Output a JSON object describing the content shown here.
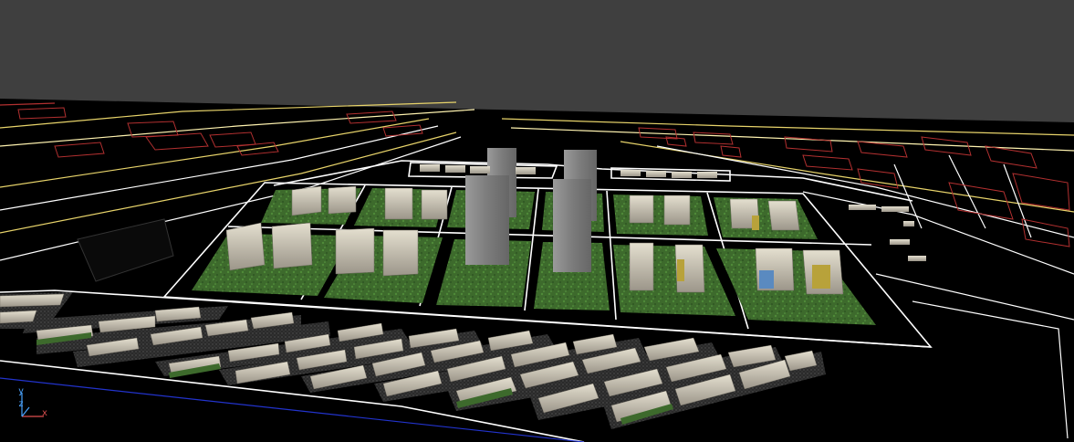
{
  "viewport": {
    "kind": "3d-perspective-viewport",
    "background_color": "#3f3f3f",
    "ground_color": "#000000",
    "grass_color": "#3e6f2e",
    "building_color": "#cfc9b8",
    "tower_color": "#8e8e8e",
    "road_line_color": "#ffffff",
    "cad_line_color": "#e7d36a",
    "parcel_line_color": "#b23030"
  },
  "axis_gizmo": {
    "x_label": "x",
    "y_label": "y",
    "z_label": "z",
    "x_color": "#e05050",
    "y_color": "#4aa3ff",
    "z_color": "#4aa3ff"
  }
}
